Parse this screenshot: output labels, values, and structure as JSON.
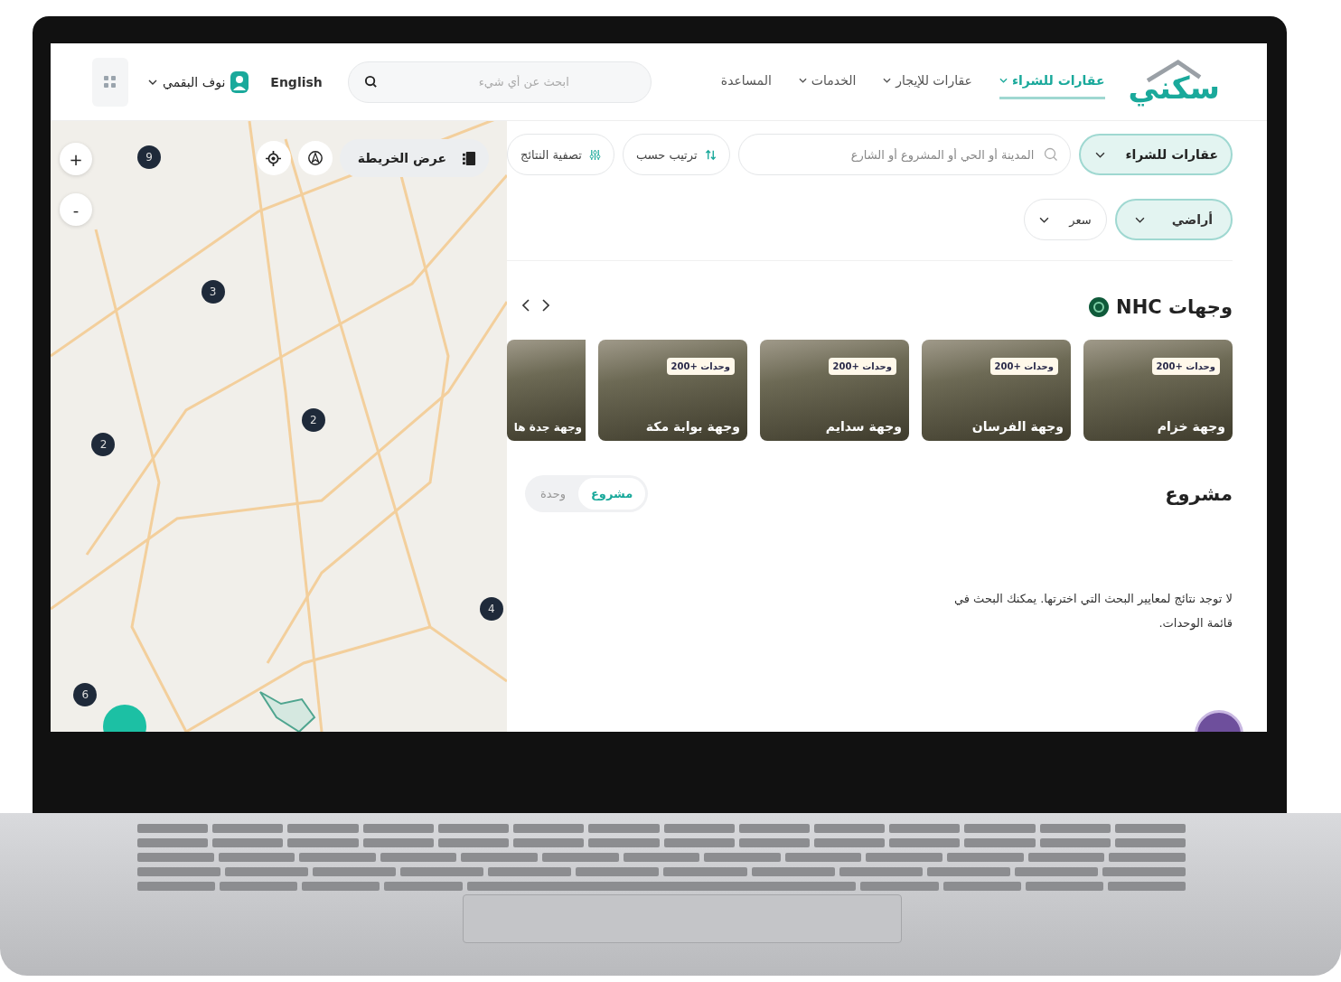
{
  "header": {
    "logo": "سكني",
    "nav": [
      {
        "label": "عقارات للشراء",
        "selected": true,
        "has_menu": true
      },
      {
        "label": "عقارات للإيجار",
        "selected": false,
        "has_menu": true
      },
      {
        "label": "الخدمات",
        "selected": false,
        "has_menu": true
      },
      {
        "label": "المساعدة",
        "selected": false,
        "has_menu": false
      }
    ],
    "search": {
      "placeholder": "ابحث عن أي شيء"
    },
    "language": "English",
    "user": "نوف البقمي"
  },
  "filters": {
    "category": "عقارات للشراء",
    "search": {
      "placeholder": "المدينة أو الحي أو المشروع أو الشارع"
    },
    "sort": "ترتيب حسب",
    "filter": "تصفية النتائج",
    "chips": [
      {
        "label": "أراضي",
        "selected": true
      },
      {
        "label": "سعر",
        "selected": false
      }
    ]
  },
  "destinations": {
    "title": "وجهات NHC",
    "cards": [
      {
        "name": "وجهة خزام",
        "badge": "وحدات +200"
      },
      {
        "name": "وجهة الفرسان",
        "badge": "وحدات +200"
      },
      {
        "name": "وجهة سدايم",
        "badge": "وحدات +200"
      },
      {
        "name": "وجهة بوابة مكة",
        "badge": "وحدات +200"
      },
      {
        "name": "وجهة جدة ها"
      }
    ]
  },
  "projects": {
    "title": "مشروع",
    "toggle": [
      {
        "label": "مشروع",
        "selected": true
      },
      {
        "label": "وحدة",
        "selected": false
      }
    ],
    "message": "لا توجد نتائج لمعايير البحث التي اخترتها. يمكنك البحث في قائمة الوحدات."
  },
  "map": {
    "view_button": "عرض الخريطة",
    "zoom_in": "+",
    "zoom_out": "-",
    "clusters": [
      {
        "count": "9"
      },
      {
        "count": "3"
      },
      {
        "count": "2"
      },
      {
        "count": "2"
      },
      {
        "count": "4"
      },
      {
        "count": "6"
      }
    ]
  }
}
